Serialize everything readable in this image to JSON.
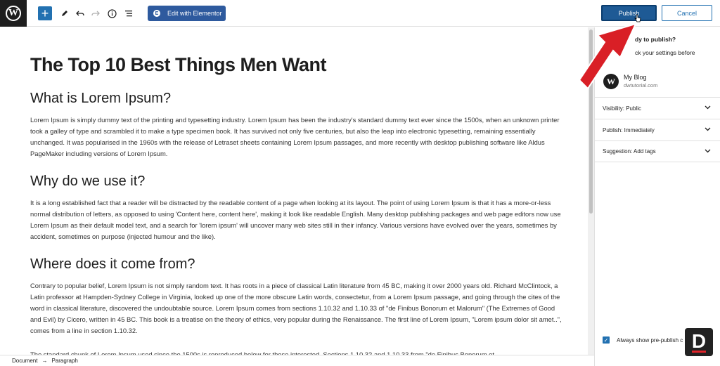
{
  "toolbar": {
    "elementor_label": "Edit with Elementor",
    "publish_label": "Publish",
    "cancel_label": "Cancel"
  },
  "post": {
    "title": "The Top 10 Best Things Men Want",
    "sections": [
      {
        "heading": "What is Lorem Ipsum?",
        "body": "Lorem Ipsum is simply dummy text of the printing and typesetting industry. Lorem Ipsum has been the industry's standard dummy text ever since the 1500s, when an unknown printer took a galley of type and scrambled it to make a type specimen book. It has survived not only five centuries, but also the leap into electronic typesetting, remaining essentially unchanged. It was popularised in the 1960s with the release of Letraset sheets containing Lorem Ipsum passages, and more recently with desktop publishing software like Aldus PageMaker including versions of Lorem Ipsum."
      },
      {
        "heading": "Why do we use it?",
        "body": "It is a long established fact that a reader will be distracted by the readable content of a page when looking at its layout. The point of using Lorem Ipsum is that it has a more-or-less normal distribution of letters, as opposed to using 'Content here, content here', making it look like readable English. Many desktop publishing packages and web page editors now use Lorem Ipsum as their default model text, and a search for 'lorem ipsum' will uncover many web sites still in their infancy. Various versions have evolved over the years, sometimes by accident, sometimes on purpose (injected humour and the like)."
      },
      {
        "heading": "Where does it come from?",
        "body": "Contrary to popular belief, Lorem Ipsum is not simply random text. It has roots in a piece of classical Latin literature from 45 BC, making it over 2000 years old. Richard McClintock, a Latin professor at Hampden-Sydney College in Virginia, looked up one of the more obscure Latin words, consectetur, from a Lorem Ipsum passage, and going through the cites of the word in classical literature, discovered the undoubtable source. Lorem Ipsum comes from sections 1.10.32 and 1.10.33 of \"de Finibus Bonorum et Malorum\" (The Extremes of Good and Evil) by Cicero, written in 45 BC. This book is a treatise on the theory of ethics, very popular during the Renaissance. The first line of Lorem Ipsum, \"Lorem ipsum dolor sit amet..\", comes from a line in section 1.10.32."
      }
    ],
    "trailing_paragraph": "The standard chunk of Lorem Ipsum used since the 1500s is reproduced below for those interested. Sections 1.10.32 and 1.10.33 from \"de Finibus Bonorum et"
  },
  "breadcrumb": {
    "root": "Document",
    "separator": "→",
    "current": "Paragraph"
  },
  "sidebar": {
    "prepublish_title": "dy to publish?",
    "prepublish_sub": "ck your settings before",
    "blog_name": "My Blog",
    "blog_url": "dwtutorial.com",
    "panels": [
      {
        "label": "Visibility: Public"
      },
      {
        "label": "Publish: Immediately"
      },
      {
        "label": "Suggestion: Add tags"
      }
    ],
    "always_show_label": "Always show pre-publish c"
  },
  "icons": {
    "logo": "wordpress-logo-icon",
    "add": "plus-icon",
    "tools": "pencil-icon",
    "undo": "undo-icon",
    "redo": "redo-icon",
    "info": "info-icon",
    "outline": "list-view-icon"
  },
  "watermark": "D",
  "colors": {
    "accent": "#2271b1",
    "publish": "#1e5a95",
    "arrow": "#d91f26"
  }
}
